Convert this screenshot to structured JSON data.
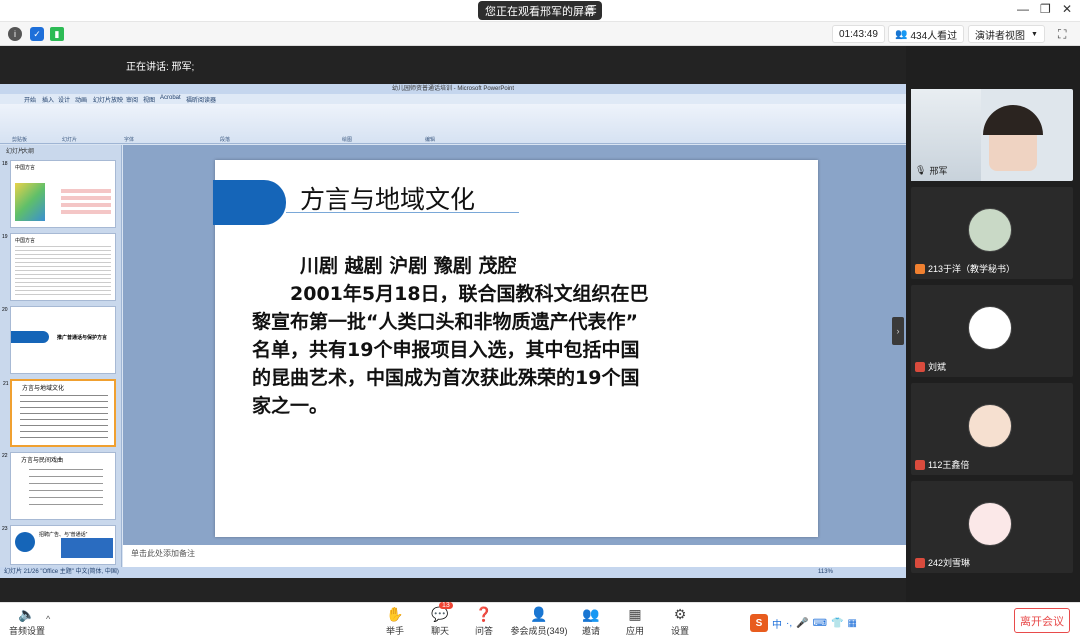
{
  "app": {
    "share_banner": "您正在观看邢军的屏幕"
  },
  "toolbar": {
    "timer": "01:43:49",
    "viewers": "434人看过",
    "view_mode": "演讲者视图"
  },
  "stage": {
    "speaking": "正在讲话: 邢军;"
  },
  "ppt": {
    "window_title": "幼儿园师资普通话培训 - Microsoft PowerPoint",
    "tabs": [
      "开始",
      "插入",
      "设计",
      "动画",
      "幻灯片放映",
      "审阅",
      "视图",
      "Acrobat",
      "福昕阅读器"
    ],
    "groups": [
      "剪贴板",
      "幻灯片",
      "字体",
      "段落",
      "绘图",
      "编辑"
    ],
    "thumb_panel_tabs": [
      "幻灯片",
      "大纲"
    ],
    "status": "幻灯片 21/26    \"Office 主题\"    中文(简体, 中国)",
    "zoom": "113%",
    "notes_placeholder": "单击此处添加备注"
  },
  "slide": {
    "title": "方言与地域文化",
    "lines": [
      "川剧 越剧 沪剧 豫剧 茂腔",
      "　　2001年5月18日，联合国教科文组织在巴",
      "黎宣布第一批“人类口头和非物质遗产代表作”",
      "名单，共有19个申报项目入选，其中包括中国",
      "的昆曲艺术，中国成为首次获此殊荣的19个国",
      "家之一。"
    ]
  },
  "thumbs": [
    {
      "num": "18",
      "title": "中国方言"
    },
    {
      "num": "19",
      "title": "中国方言"
    },
    {
      "num": "20",
      "title": "推广普通话与保护方言"
    },
    {
      "num": "21",
      "title": "方言与地域文化"
    },
    {
      "num": "22",
      "title": "方言与民间戏曲"
    },
    {
      "num": "23",
      "title": "招聘广告、与“普通话”"
    }
  ],
  "participants": [
    {
      "name": "邢军"
    },
    {
      "name": "213于洋（教学秘书）"
    },
    {
      "name": "刘斌"
    },
    {
      "name": "112王鑫倍"
    },
    {
      "name": "242刘雪琳"
    }
  ],
  "bottom": {
    "audio": "音频设置",
    "items": [
      "举手",
      "聊天",
      "问答",
      "参会成员(349)",
      "邀请",
      "应用",
      "设置"
    ],
    "chat_badge": "13",
    "leave": "离开会议",
    "ime": "中"
  },
  "colors": {
    "accent": "#1565b8",
    "leave": "#e84b4b"
  }
}
